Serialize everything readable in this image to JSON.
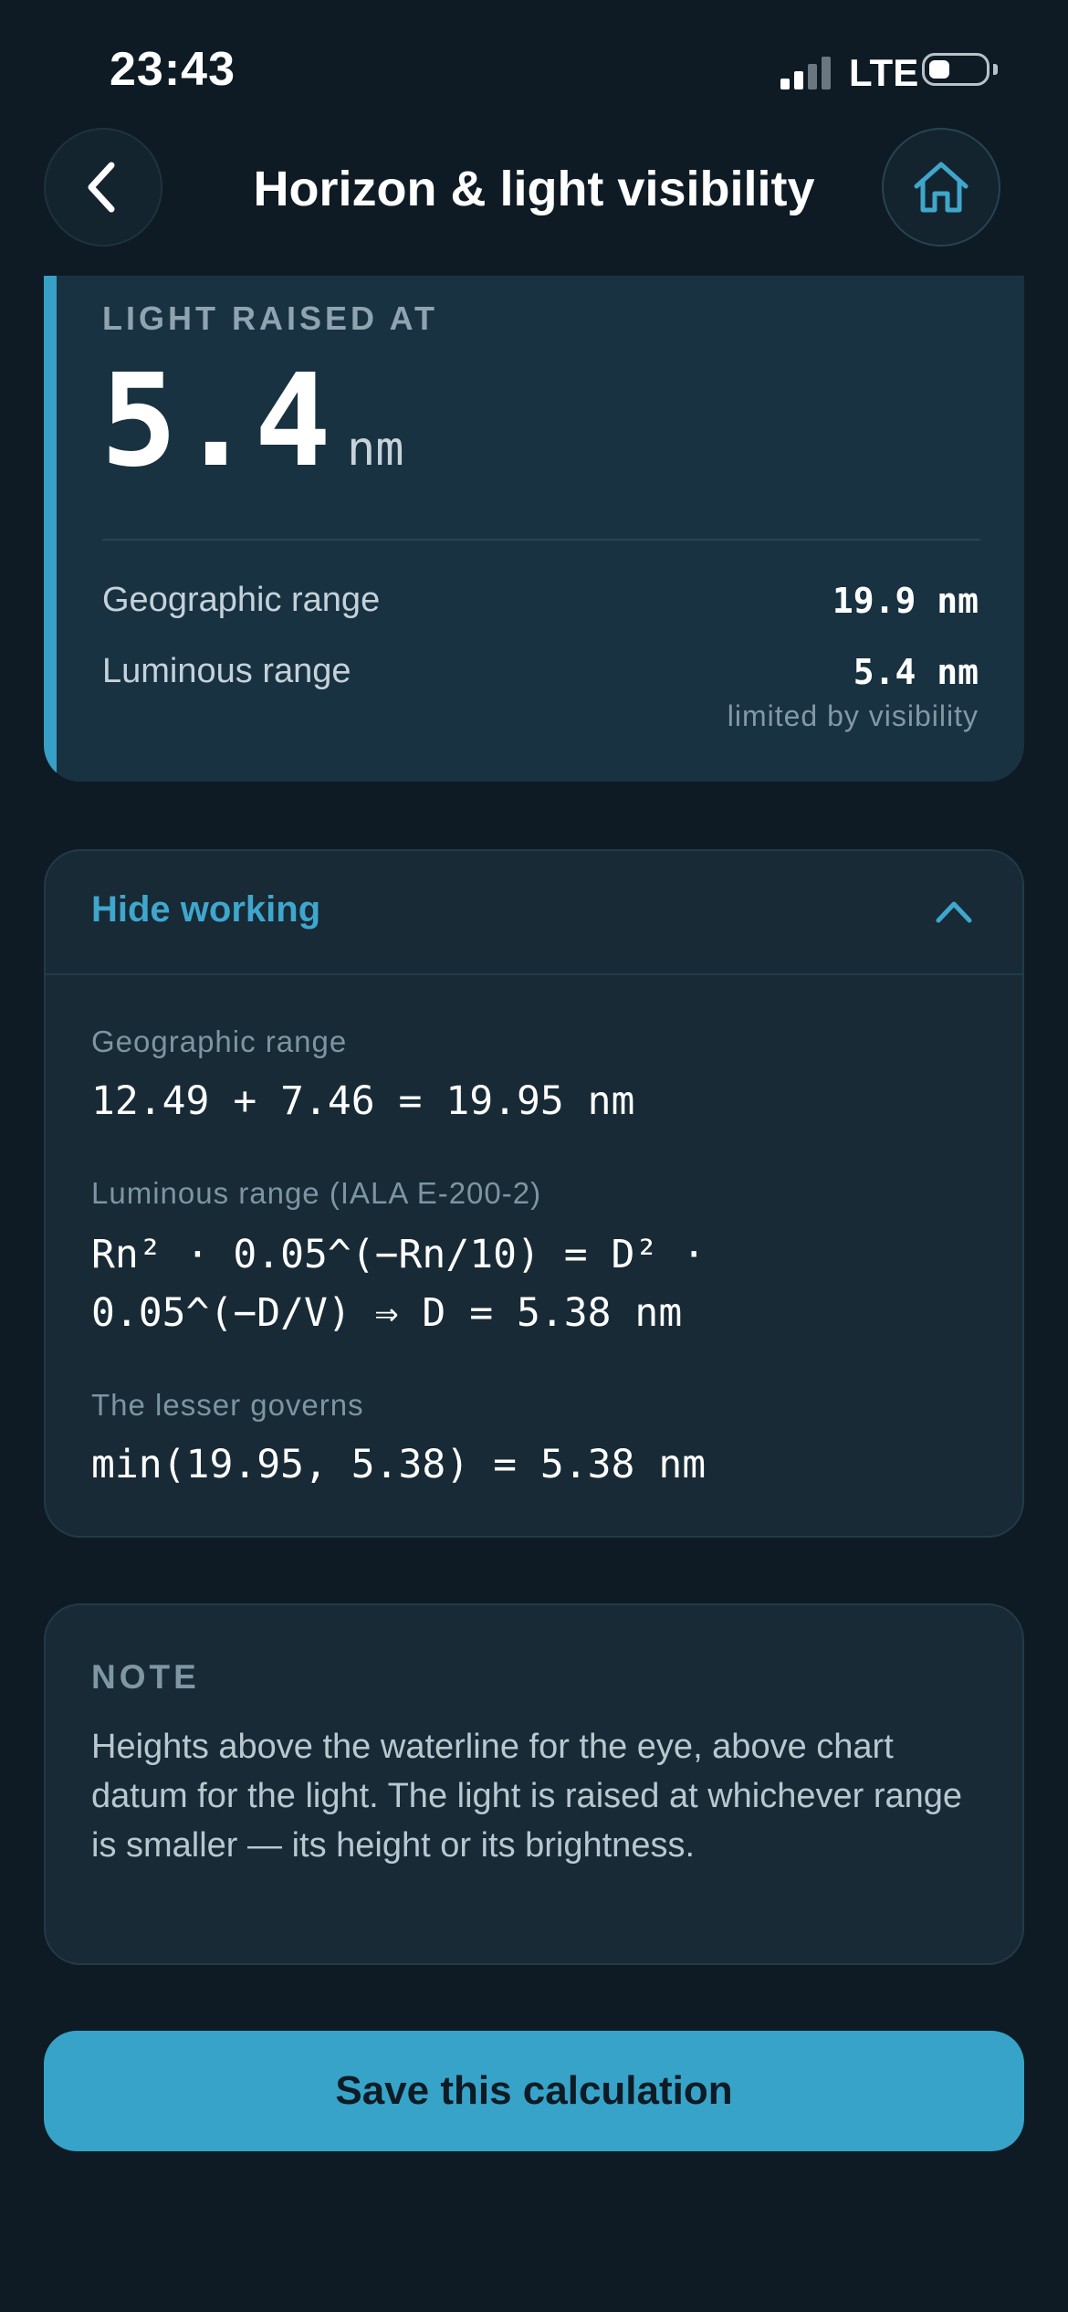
{
  "status_bar": {
    "time": "23:43",
    "network": "LTE"
  },
  "header": {
    "title": "Horizon & light visibility",
    "back_icon": "chevron-left-icon",
    "home_icon": "home-icon"
  },
  "result": {
    "label": "LIGHT RAISED AT",
    "value": "5.4",
    "unit": "nm",
    "rows": [
      {
        "label": "Geographic range",
        "value": "19.9 nm"
      },
      {
        "label": "Luminous range",
        "value": "5.4 nm",
        "note": "limited by visibility"
      }
    ]
  },
  "working": {
    "toggle_label": "Hide working",
    "expanded": true,
    "sections": [
      {
        "label": "Geographic range",
        "formula": "12.49 + 7.46 = 19.95 nm"
      },
      {
        "label": "Luminous range (IALA E-200-2)",
        "formula_line1": "Rn² · 0.05^(−Rn/10) = D² ·",
        "formula_line2": "0.05^(−D/V)  ⇒  D = 5.38 nm"
      },
      {
        "label": "The lesser governs",
        "formula": "min(19.95, 5.38) = 5.38 nm"
      }
    ]
  },
  "note": {
    "heading": "NOTE",
    "text": "Heights above the waterline for the eye, above chart datum for the light. The light is raised at whichever range is smaller — its height or its brightness."
  },
  "actions": {
    "save_label": "Save this calculation"
  },
  "colors": {
    "background": "#0e1b25",
    "accent": "#37a3c9",
    "card": "#193242"
  }
}
